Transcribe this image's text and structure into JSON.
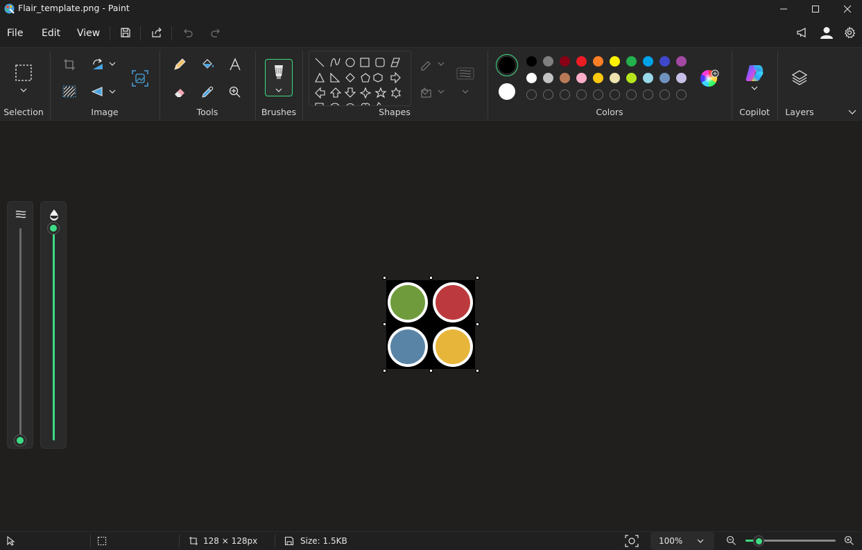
{
  "window": {
    "title": "Flair_template.png - Paint"
  },
  "menu": {
    "file": "File",
    "edit": "Edit",
    "view": "View"
  },
  "ribbon": {
    "groups": {
      "selection": "Selection",
      "image": "Image",
      "tools": "Tools",
      "brushes": "Brushes",
      "shapes": "Shapes",
      "colors": "Colors",
      "copilot": "Copilot",
      "layers": "Layers"
    },
    "primary_color": "#000000",
    "secondary_color": "#ffffff",
    "palette": [
      [
        "#000000",
        "#7f7f7f",
        "#880015",
        "#ed1c24",
        "#ff7f27",
        "#fff200",
        "#22b14c",
        "#00a2e8",
        "#3f48cc",
        "#a349a4"
      ],
      [
        "#ffffff",
        "#c3c3c3",
        "#b97a57",
        "#ffaec9",
        "#ffc90e",
        "#efe4b0",
        "#b5e61d",
        "#99d9ea",
        "#7092be",
        "#c8bfe7"
      ],
      [
        "",
        "",
        "",
        "",
        "",
        "",
        "",
        "",
        "",
        ""
      ]
    ]
  },
  "canvas": {
    "image_colors": {
      "top_left": "#6f9b3c",
      "top_right": "#bc3a3d",
      "bottom_left": "#5a84a6",
      "bottom_right": "#e8b53b"
    }
  },
  "sliders": {
    "size_value": 0.0,
    "opacity_value": 1.0,
    "accent": "#3ddc84"
  },
  "status": {
    "dimensions": "128 × 128px",
    "size": "Size: 1.5KB",
    "zoom": "100%"
  }
}
